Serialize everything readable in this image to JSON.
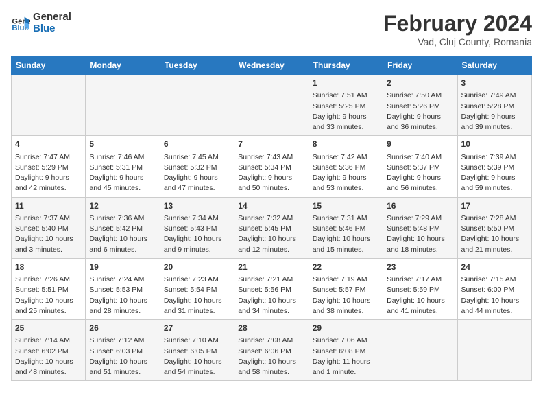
{
  "logo": {
    "line1": "General",
    "line2": "Blue"
  },
  "title": "February 2024",
  "subtitle": "Vad, Cluj County, Romania",
  "days_of_week": [
    "Sunday",
    "Monday",
    "Tuesday",
    "Wednesday",
    "Thursday",
    "Friday",
    "Saturday"
  ],
  "weeks": [
    [
      {
        "day": "",
        "info": ""
      },
      {
        "day": "",
        "info": ""
      },
      {
        "day": "",
        "info": ""
      },
      {
        "day": "",
        "info": ""
      },
      {
        "day": "1",
        "info": "Sunrise: 7:51 AM\nSunset: 5:25 PM\nDaylight: 9 hours and 33 minutes."
      },
      {
        "day": "2",
        "info": "Sunrise: 7:50 AM\nSunset: 5:26 PM\nDaylight: 9 hours and 36 minutes."
      },
      {
        "day": "3",
        "info": "Sunrise: 7:49 AM\nSunset: 5:28 PM\nDaylight: 9 hours and 39 minutes."
      }
    ],
    [
      {
        "day": "4",
        "info": "Sunrise: 7:47 AM\nSunset: 5:29 PM\nDaylight: 9 hours and 42 minutes."
      },
      {
        "day": "5",
        "info": "Sunrise: 7:46 AM\nSunset: 5:31 PM\nDaylight: 9 hours and 45 minutes."
      },
      {
        "day": "6",
        "info": "Sunrise: 7:45 AM\nSunset: 5:32 PM\nDaylight: 9 hours and 47 minutes."
      },
      {
        "day": "7",
        "info": "Sunrise: 7:43 AM\nSunset: 5:34 PM\nDaylight: 9 hours and 50 minutes."
      },
      {
        "day": "8",
        "info": "Sunrise: 7:42 AM\nSunset: 5:36 PM\nDaylight: 9 hours and 53 minutes."
      },
      {
        "day": "9",
        "info": "Sunrise: 7:40 AM\nSunset: 5:37 PM\nDaylight: 9 hours and 56 minutes."
      },
      {
        "day": "10",
        "info": "Sunrise: 7:39 AM\nSunset: 5:39 PM\nDaylight: 9 hours and 59 minutes."
      }
    ],
    [
      {
        "day": "11",
        "info": "Sunrise: 7:37 AM\nSunset: 5:40 PM\nDaylight: 10 hours and 3 minutes."
      },
      {
        "day": "12",
        "info": "Sunrise: 7:36 AM\nSunset: 5:42 PM\nDaylight: 10 hours and 6 minutes."
      },
      {
        "day": "13",
        "info": "Sunrise: 7:34 AM\nSunset: 5:43 PM\nDaylight: 10 hours and 9 minutes."
      },
      {
        "day": "14",
        "info": "Sunrise: 7:32 AM\nSunset: 5:45 PM\nDaylight: 10 hours and 12 minutes."
      },
      {
        "day": "15",
        "info": "Sunrise: 7:31 AM\nSunset: 5:46 PM\nDaylight: 10 hours and 15 minutes."
      },
      {
        "day": "16",
        "info": "Sunrise: 7:29 AM\nSunset: 5:48 PM\nDaylight: 10 hours and 18 minutes."
      },
      {
        "day": "17",
        "info": "Sunrise: 7:28 AM\nSunset: 5:50 PM\nDaylight: 10 hours and 21 minutes."
      }
    ],
    [
      {
        "day": "18",
        "info": "Sunrise: 7:26 AM\nSunset: 5:51 PM\nDaylight: 10 hours and 25 minutes."
      },
      {
        "day": "19",
        "info": "Sunrise: 7:24 AM\nSunset: 5:53 PM\nDaylight: 10 hours and 28 minutes."
      },
      {
        "day": "20",
        "info": "Sunrise: 7:23 AM\nSunset: 5:54 PM\nDaylight: 10 hours and 31 minutes."
      },
      {
        "day": "21",
        "info": "Sunrise: 7:21 AM\nSunset: 5:56 PM\nDaylight: 10 hours and 34 minutes."
      },
      {
        "day": "22",
        "info": "Sunrise: 7:19 AM\nSunset: 5:57 PM\nDaylight: 10 hours and 38 minutes."
      },
      {
        "day": "23",
        "info": "Sunrise: 7:17 AM\nSunset: 5:59 PM\nDaylight: 10 hours and 41 minutes."
      },
      {
        "day": "24",
        "info": "Sunrise: 7:15 AM\nSunset: 6:00 PM\nDaylight: 10 hours and 44 minutes."
      }
    ],
    [
      {
        "day": "25",
        "info": "Sunrise: 7:14 AM\nSunset: 6:02 PM\nDaylight: 10 hours and 48 minutes."
      },
      {
        "day": "26",
        "info": "Sunrise: 7:12 AM\nSunset: 6:03 PM\nDaylight: 10 hours and 51 minutes."
      },
      {
        "day": "27",
        "info": "Sunrise: 7:10 AM\nSunset: 6:05 PM\nDaylight: 10 hours and 54 minutes."
      },
      {
        "day": "28",
        "info": "Sunrise: 7:08 AM\nSunset: 6:06 PM\nDaylight: 10 hours and 58 minutes."
      },
      {
        "day": "29",
        "info": "Sunrise: 7:06 AM\nSunset: 6:08 PM\nDaylight: 11 hours and 1 minute."
      },
      {
        "day": "",
        "info": ""
      },
      {
        "day": "",
        "info": ""
      }
    ]
  ]
}
